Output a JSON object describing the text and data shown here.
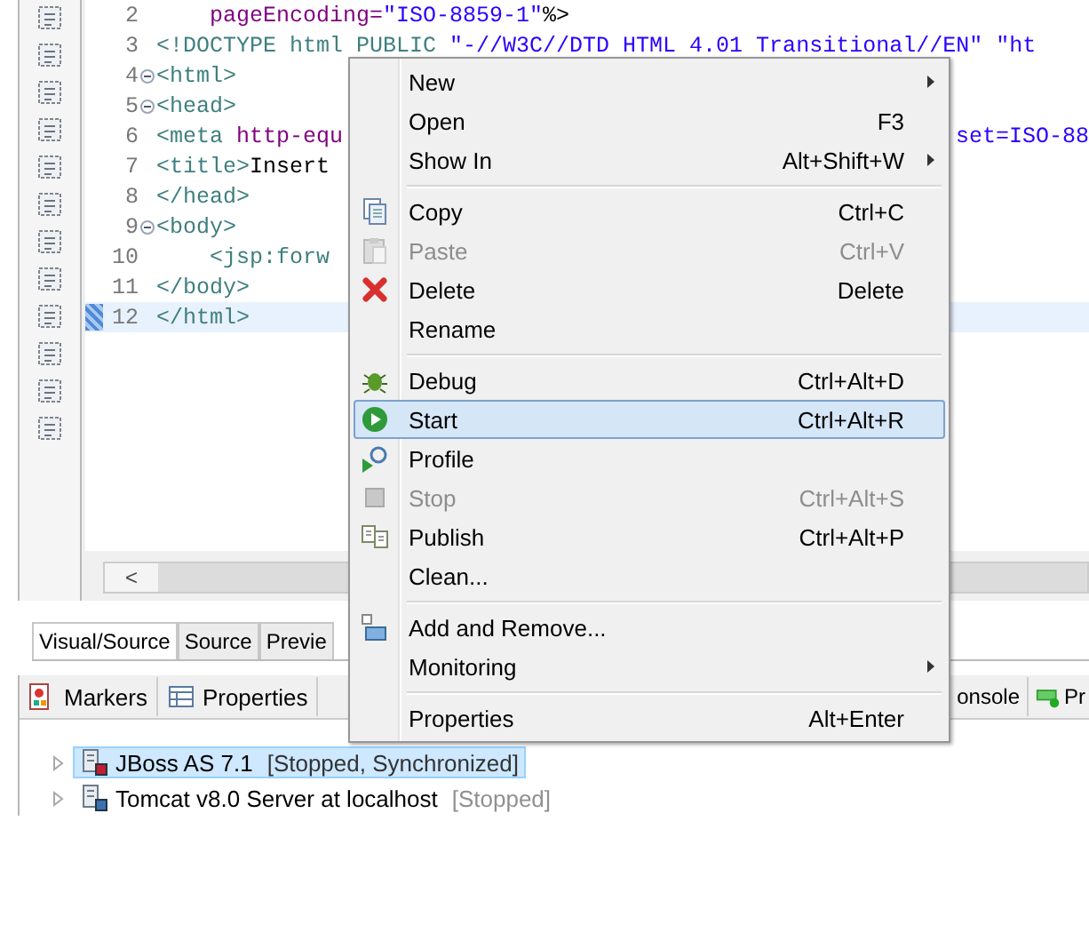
{
  "editor": {
    "lines": [
      {
        "number": "2",
        "fold": false,
        "current": false,
        "left": [
          {
            "text": "    pageEncoding=",
            "kind": "attr"
          },
          {
            "text": "\"ISO-8859-1\"",
            "kind": "string"
          },
          {
            "text": "%>",
            "kind": "text"
          }
        ]
      },
      {
        "number": "3",
        "fold": false,
        "current": false,
        "left": [
          {
            "text": "<!DOCTYPE html PUBLIC ",
            "kind": "tag"
          },
          {
            "text": "\"-//W3C//DTD HTML 4.01 Transitional//EN\" \"ht",
            "kind": "string"
          }
        ]
      },
      {
        "number": "4",
        "fold": true,
        "current": false,
        "left": [
          {
            "text": "<html>",
            "kind": "tag"
          }
        ]
      },
      {
        "number": "5",
        "fold": true,
        "current": false,
        "left": [
          {
            "text": "<head>",
            "kind": "tag"
          }
        ]
      },
      {
        "number": "6",
        "fold": false,
        "current": false,
        "left": [
          {
            "text": "<meta ",
            "kind": "tag"
          },
          {
            "text": "http-equ",
            "kind": "attr"
          }
        ],
        "right": [
          {
            "text": "set=ISO-88",
            "kind": "string"
          }
        ]
      },
      {
        "number": "7",
        "fold": false,
        "current": false,
        "left": [
          {
            "text": "<title>",
            "kind": "tag"
          },
          {
            "text": "Insert",
            "kind": "text"
          }
        ]
      },
      {
        "number": "8",
        "fold": false,
        "current": false,
        "left": [
          {
            "text": "</head>",
            "kind": "tag"
          }
        ]
      },
      {
        "number": "9",
        "fold": true,
        "current": false,
        "left": [
          {
            "text": "<body>",
            "kind": "tag"
          }
        ]
      },
      {
        "number": "10",
        "fold": false,
        "current": false,
        "left": [
          {
            "text": "    <jsp:forw",
            "kind": "tag"
          }
        ]
      },
      {
        "number": "11",
        "fold": false,
        "current": false,
        "left": [
          {
            "text": "</body>",
            "kind": "tag"
          }
        ]
      },
      {
        "number": "12",
        "fold": false,
        "current": true,
        "left": [
          {
            "text": "</html>",
            "kind": "tag"
          }
        ]
      }
    ],
    "scroll_left": "<",
    "tabs": [
      {
        "label": "Visual/Source",
        "selected": true
      },
      {
        "label": "Source",
        "selected": false
      },
      {
        "label": "Previe",
        "selected": false
      }
    ]
  },
  "context_menu": {
    "items": [
      {
        "kind": "item",
        "label": "New",
        "submenu": true,
        "disabled": false,
        "selected": false
      },
      {
        "kind": "item",
        "label": "Open",
        "shortcut": "F3",
        "submenu": false,
        "disabled": false,
        "selected": false
      },
      {
        "kind": "item",
        "label": "Show In",
        "shortcut": "Alt+Shift+W",
        "submenu": true,
        "disabled": false,
        "selected": false
      },
      {
        "kind": "separator"
      },
      {
        "kind": "item",
        "label": "Copy",
        "shortcut": "Ctrl+C",
        "submenu": false,
        "disabled": false,
        "selected": false
      },
      {
        "kind": "item",
        "label": "Paste",
        "shortcut": "Ctrl+V",
        "submenu": false,
        "disabled": true,
        "selected": false
      },
      {
        "kind": "item",
        "label": "Delete",
        "shortcut": "Delete",
        "submenu": false,
        "disabled": false,
        "selected": false
      },
      {
        "kind": "item",
        "label": "Rename",
        "submenu": false,
        "disabled": false,
        "selected": false
      },
      {
        "kind": "separator"
      },
      {
        "kind": "item",
        "label": "Debug",
        "shortcut": "Ctrl+Alt+D",
        "submenu": false,
        "disabled": false,
        "selected": false
      },
      {
        "kind": "item",
        "label": "Start",
        "shortcut": "Ctrl+Alt+R",
        "submenu": false,
        "disabled": false,
        "selected": true
      },
      {
        "kind": "item",
        "label": "Profile",
        "submenu": false,
        "disabled": false,
        "selected": false
      },
      {
        "kind": "item",
        "label": "Stop",
        "shortcut": "Ctrl+Alt+S",
        "submenu": false,
        "disabled": true,
        "selected": false
      },
      {
        "kind": "item",
        "label": "Publish",
        "shortcut": "Ctrl+Alt+P",
        "submenu": false,
        "disabled": false,
        "selected": false
      },
      {
        "kind": "item",
        "label": "Clean...",
        "submenu": false,
        "disabled": false,
        "selected": false
      },
      {
        "kind": "separator"
      },
      {
        "kind": "item",
        "label": "Add and Remove...",
        "submenu": false,
        "disabled": false,
        "selected": false
      },
      {
        "kind": "item",
        "label": "Monitoring",
        "submenu": true,
        "disabled": false,
        "selected": false
      },
      {
        "kind": "separator"
      },
      {
        "kind": "item",
        "label": "Properties",
        "shortcut": "Alt+Enter",
        "submenu": false,
        "disabled": false,
        "selected": false
      }
    ]
  },
  "bottom_panel": {
    "tabs": [
      {
        "label": "Markers"
      },
      {
        "label": "Properties"
      }
    ],
    "right_tabs": [
      {
        "label": "onsole"
      },
      {
        "label": "Pr"
      }
    ],
    "servers": [
      {
        "name": "JBoss AS 7.1",
        "status": "[Stopped, Synchronized]",
        "selected": true
      },
      {
        "name": "Tomcat v8.0 Server at localhost",
        "status": "[Stopped]",
        "selected": false
      }
    ]
  }
}
